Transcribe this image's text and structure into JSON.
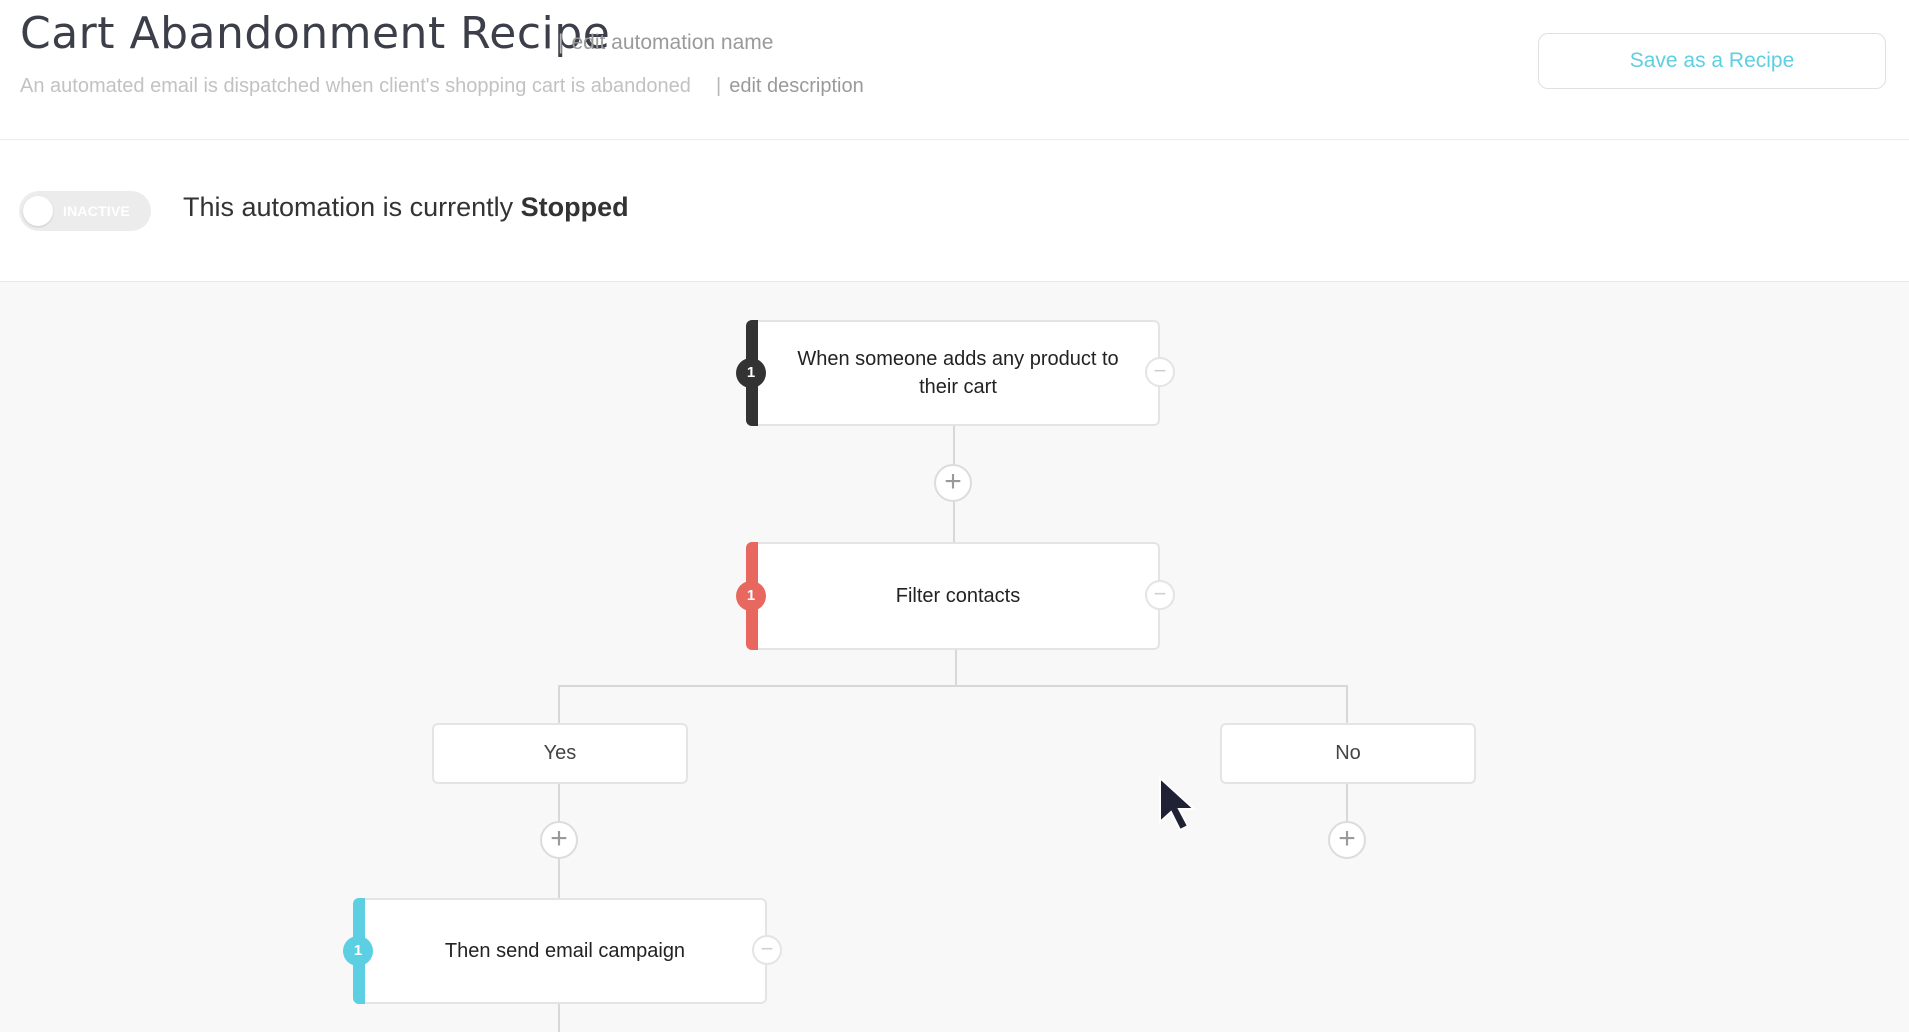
{
  "header": {
    "title": "Cart Abandonment Recipe",
    "edit_name": "edit automation name",
    "description": "An automated email is dispatched when client's shopping cart is abandoned",
    "edit_description": "edit description",
    "save_button": "Save as a Recipe",
    "separator": "|"
  },
  "status": {
    "toggle_label": "INACTIVE",
    "text_prefix": "This automation is currently",
    "state": "Stopped"
  },
  "workflow": {
    "trigger": {
      "badge": "1",
      "label": "When someone adds any product to their cart",
      "color": "#333333"
    },
    "filter": {
      "badge": "1",
      "label": "Filter contacts",
      "color": "#e8675e"
    },
    "branch_yes": "Yes",
    "branch_no": "No",
    "action": {
      "badge": "1",
      "label": "Then send email campaign",
      "color": "#5ccfe2"
    },
    "add_symbol": "+",
    "remove_symbol": "−"
  },
  "colors": {
    "accent": "#5ccfe2",
    "title": "#3c3f4a",
    "canvas_bg": "#f8f8f8"
  }
}
